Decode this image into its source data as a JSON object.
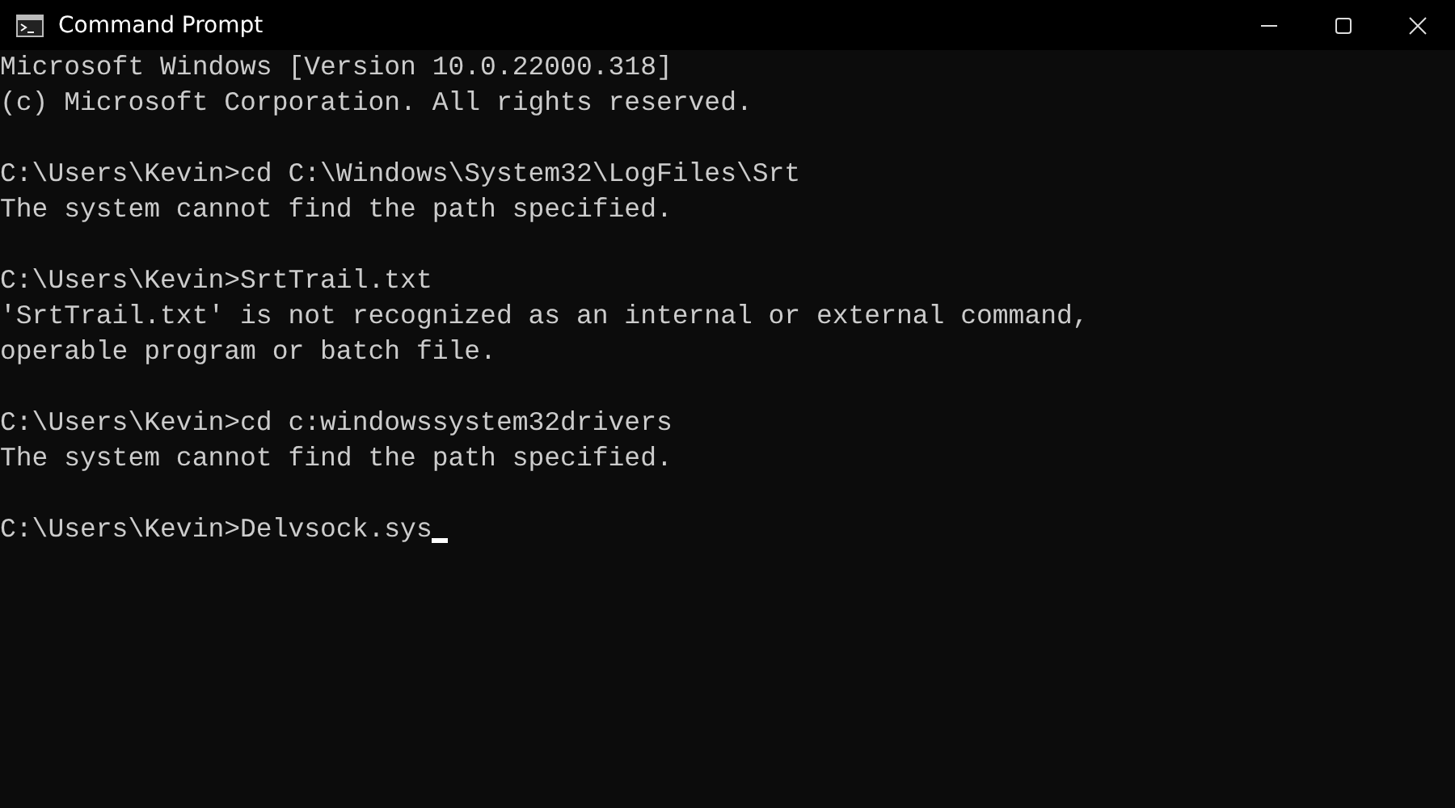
{
  "window": {
    "title": "Command Prompt"
  },
  "console": {
    "blocks": [
      {
        "lines": [
          "Microsoft Windows [Version 10.0.22000.318]",
          "(c) Microsoft Corporation. All rights reserved."
        ]
      },
      {
        "lines": [
          "C:\\Users\\Kevin>cd C:\\Windows\\System32\\LogFiles\\Srt",
          "The system cannot find the path specified."
        ]
      },
      {
        "lines": [
          "C:\\Users\\Kevin>SrtTrail.txt",
          "'SrtTrail.txt' is not recognized as an internal or external command,",
          "operable program or batch file."
        ]
      },
      {
        "lines": [
          "C:\\Users\\Kevin>cd c:windowssystem32drivers",
          "The system cannot find the path specified."
        ]
      },
      {
        "lines": [
          "C:\\Users\\Kevin>Delvsock.sys"
        ]
      }
    ],
    "cursor_visible": true
  }
}
